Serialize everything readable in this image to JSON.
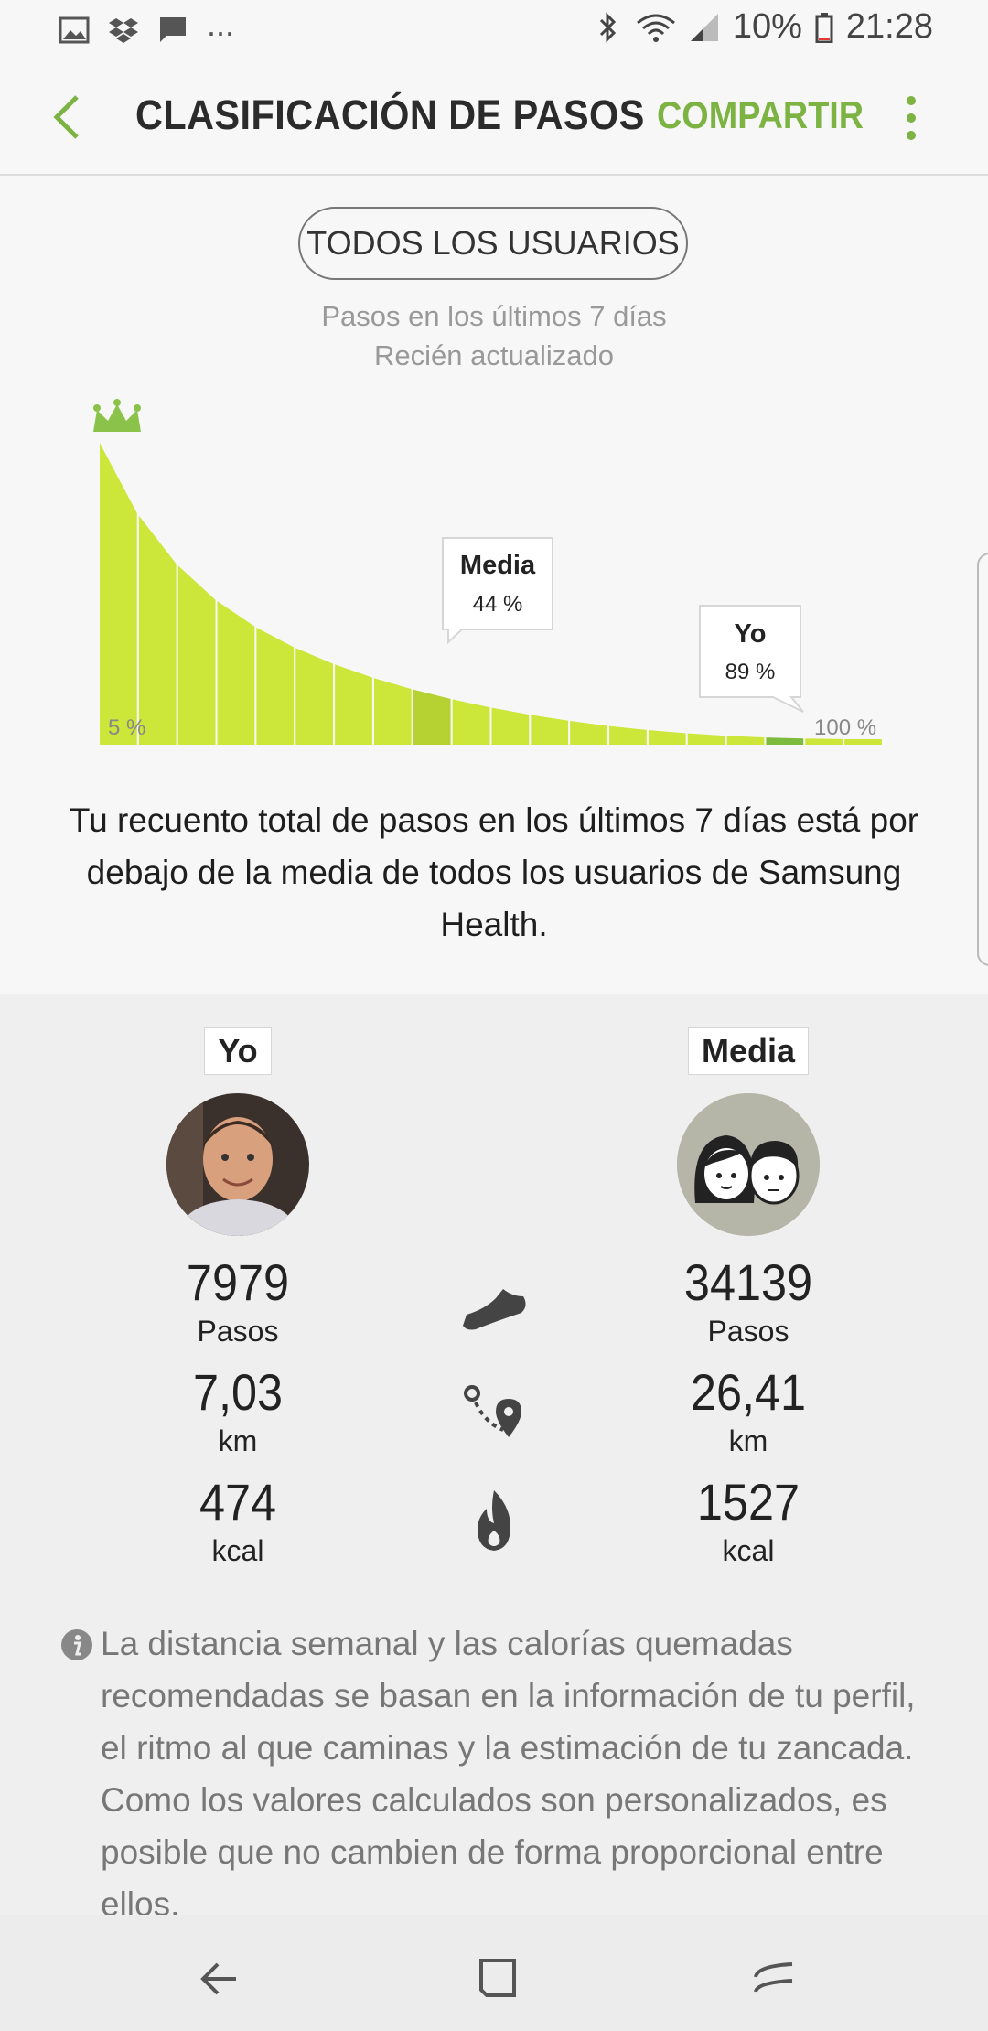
{
  "status_bar": {
    "battery": "10%",
    "time": "21:28",
    "overflow": "..."
  },
  "app_bar": {
    "title": "CLASIFICACIÓN DE PASOS",
    "share_label": "COMPARTIR"
  },
  "filter": {
    "label": "TODOS LOS USUARIOS"
  },
  "chart_info": {
    "line1": "Pasos en los últimos 7 días",
    "line2": "Recién actualizado"
  },
  "chart_data": {
    "type": "area",
    "x_start_label": "5 %",
    "x_end_label": "100 %",
    "markers": [
      {
        "label": "Media",
        "value": "44 %",
        "percentile": 44
      },
      {
        "label": "Yo",
        "value": "89 %",
        "percentile": 89
      }
    ],
    "colors": {
      "area": "#cce63a",
      "average": "#b6d232",
      "me": "#7dbb3f",
      "crown": "#8bc34a"
    }
  },
  "summary": "Tu recuento total de pasos en los últimos 7 días está por debajo de la media de todos los usuarios de Samsung Health.",
  "comparison": {
    "me": {
      "tag": "Yo",
      "steps": "7979",
      "steps_unit": "Pasos",
      "distance": "7,03",
      "distance_unit": "km",
      "calories": "474",
      "calories_unit": "kcal"
    },
    "average": {
      "tag": "Media",
      "steps": "34139",
      "steps_unit": "Pasos",
      "distance": "26,41",
      "distance_unit": "km",
      "calories": "1527",
      "calories_unit": "kcal"
    },
    "icons": [
      "shoe-icon",
      "route-icon",
      "flame-icon"
    ]
  },
  "info_note": "La distancia semanal y las calorías quemadas recomendadas se basan en la información de tu perfil, el ritmo al que caminas y la estimación de tu zancada. Como los valores calculados son personalizados, es posible que no cambien de forma proporcional entre ellos.",
  "theme": {
    "accent": "#7cb342"
  }
}
